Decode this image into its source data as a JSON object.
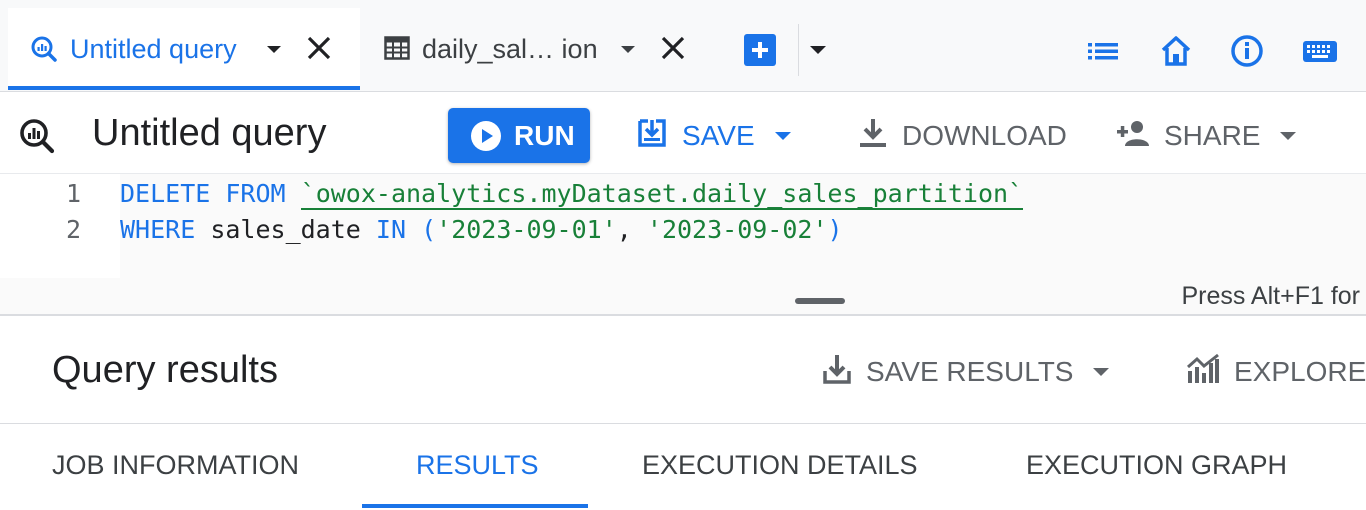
{
  "tabs": {
    "active": {
      "label": "Untitled query",
      "icon": "query-icon"
    },
    "inactive": {
      "label": "daily_sal… ion",
      "icon": "table-icon"
    },
    "new_tab_icon": "add-icon",
    "more_tabs_icon": "chevron-down-icon"
  },
  "top_icons": [
    "list-icon",
    "home-icon",
    "info-icon",
    "keyboard-icon"
  ],
  "toolbar": {
    "title": "Untitled query",
    "run_label": "RUN",
    "save_label": "SAVE",
    "download_label": "DOWNLOAD",
    "share_label": "SHARE"
  },
  "editor": {
    "line_numbers": [
      "1",
      "2"
    ],
    "line1": {
      "kw": "DELETE FROM",
      "table": "`owox-analytics.myDataset.daily_sales_partition`"
    },
    "line2": {
      "kw1": "WHERE",
      "col": "sales_date",
      "kw2": "IN",
      "open": "(",
      "v1": "'2023-09-01'",
      "comma": ",",
      "v2": "'2023-09-02'",
      "close": ")"
    },
    "hint": "Press Alt+F1 for"
  },
  "results": {
    "title": "Query results",
    "save_results_label": "SAVE RESULTS",
    "explore_label": "EXPLORE D",
    "tabs": [
      "JOB INFORMATION",
      "RESULTS",
      "EXECUTION DETAILS",
      "EXECUTION GRAPH"
    ],
    "selected_tab": "RESULTS"
  },
  "colors": {
    "accent": "#1a73e8",
    "string": "#188038",
    "muted": "#5f6368"
  }
}
